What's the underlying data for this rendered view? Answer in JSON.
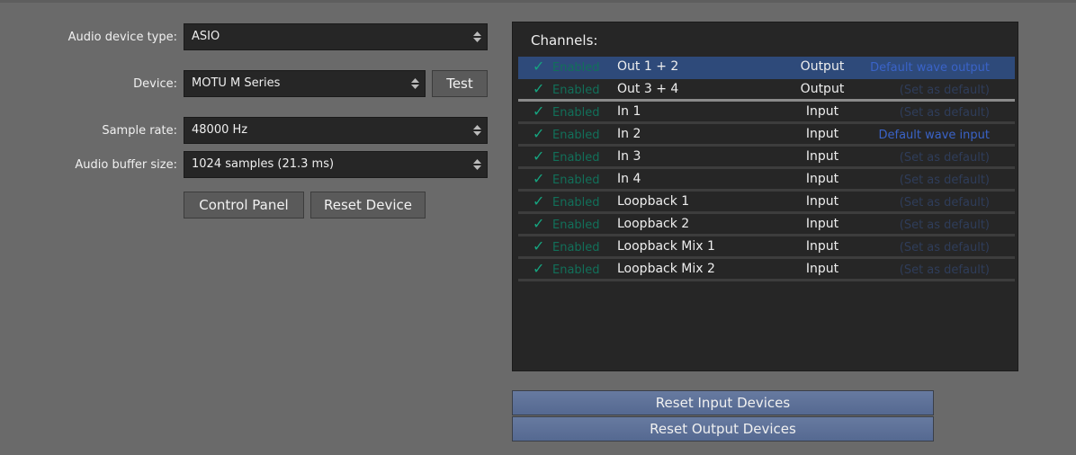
{
  "settings": {
    "device_type_label": "Audio device type:",
    "device_type_value": "ASIO",
    "device_label": "Device:",
    "device_value": "MOTU M Series",
    "test_button": "Test",
    "sample_rate_label": "Sample rate:",
    "sample_rate_value": "48000 Hz",
    "buffer_label": "Audio buffer size:",
    "buffer_value": "1024 samples (21.3 ms)",
    "control_panel_button": "Control Panel",
    "reset_device_button": "Reset Device"
  },
  "channels": {
    "title": "Channels:",
    "rows": [
      {
        "status": "Enabled",
        "name": "Out 1 + 2",
        "type": "Output",
        "default": "Default wave output"
      },
      {
        "status": "Enabled",
        "name": "Out 3 + 4",
        "type": "Output",
        "default": "(Set as default)"
      },
      {
        "status": "Enabled",
        "name": "In 1",
        "type": "Input",
        "default": "(Set as default)"
      },
      {
        "status": "Enabled",
        "name": "In 2",
        "type": "Input",
        "default": "Default wave input"
      },
      {
        "status": "Enabled",
        "name": "In 3",
        "type": "Input",
        "default": "(Set as default)"
      },
      {
        "status": "Enabled",
        "name": "In 4",
        "type": "Input",
        "default": "(Set as default)"
      },
      {
        "status": "Enabled",
        "name": "Loopback 1",
        "type": "Input",
        "default": "(Set as default)"
      },
      {
        "status": "Enabled",
        "name": "Loopback 2",
        "type": "Input",
        "default": "(Set as default)"
      },
      {
        "status": "Enabled",
        "name": "Loopback Mix 1",
        "type": "Input",
        "default": "(Set as default)"
      },
      {
        "status": "Enabled",
        "name": "Loopback Mix 2",
        "type": "Input",
        "default": "(Set as default)"
      }
    ]
  },
  "reset_input_button": "Reset Input Devices",
  "reset_output_button": "Reset Output Devices"
}
